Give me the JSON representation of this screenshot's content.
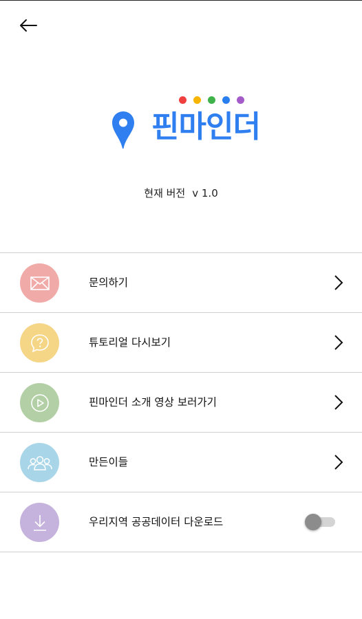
{
  "app": {
    "name": "핀마인더",
    "brand_color": "#2f7ff0",
    "dot_colors": [
      "#f04040",
      "#f7b500",
      "#3fb24a",
      "#2a7ff0",
      "#a45bc9"
    ]
  },
  "version": {
    "label": "현재 버전",
    "value": "v 1.0"
  },
  "menu": {
    "items": [
      {
        "label": "문의하기",
        "icon": "mail-icon",
        "color": "#f0aaa8",
        "action": "chevron"
      },
      {
        "label": "튜토리얼 다시보기",
        "icon": "question-bubble-icon",
        "color": "#f5d687",
        "action": "chevron"
      },
      {
        "label": "핀마인더 소개 영상 보러가기",
        "icon": "play-icon",
        "color": "#b3cfa5",
        "action": "chevron"
      },
      {
        "label": "만든이들",
        "icon": "people-icon",
        "color": "#a8d6e8",
        "action": "chevron"
      },
      {
        "label": "우리지역 공공데이터 다운로드",
        "icon": "download-icon",
        "color": "#c5b2dd",
        "action": "toggle",
        "toggle_on": false
      }
    ]
  }
}
